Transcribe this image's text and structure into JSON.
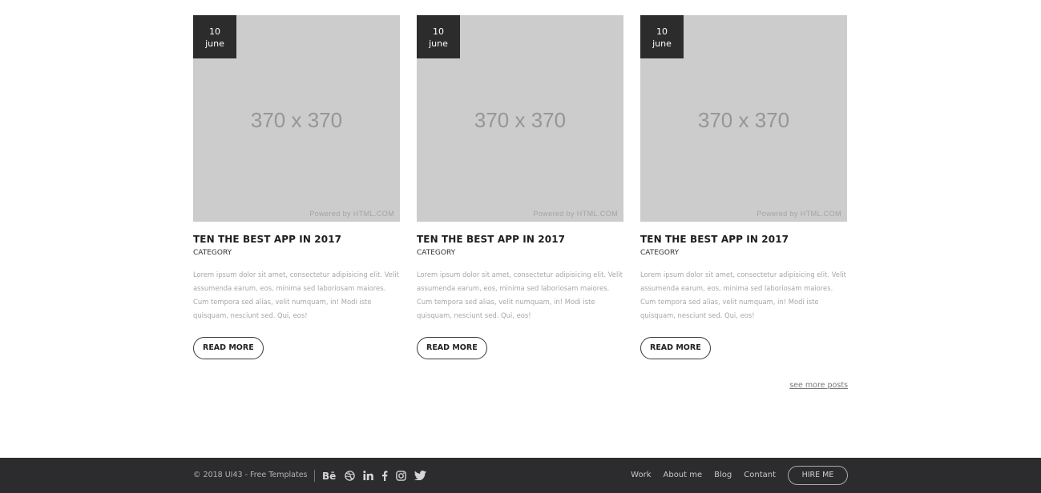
{
  "posts": [
    {
      "date_day": "10",
      "date_month": "june",
      "image_size_label": "370 x 370",
      "image_credit": "Powered by HTML.COM",
      "title": "TEN THE BEST APP IN 2017",
      "category": "CATEGORY",
      "excerpt": "Lorem ipsum dolor sit amet, consectetur adipisicing elit. Velit assumenda earum, eos, minima sed laboriosam maiores. Cum tempora sed alias, velit numquam, in! Modi iste quisquam, nesciunt sed. Qui, eos!",
      "button_label": "READ MORE"
    },
    {
      "date_day": "10",
      "date_month": "june",
      "image_size_label": "370 x 370",
      "image_credit": "Powered by HTML.COM",
      "title": "TEN THE BEST APP IN 2017",
      "category": "CATEGORY",
      "excerpt": "Lorem ipsum dolor sit amet, consectetur adipisicing elit. Velit assumenda earum, eos, minima sed laboriosam maiores. Cum tempora sed alias, velit numquam, in! Modi iste quisquam, nesciunt sed. Qui, eos!",
      "button_label": "READ MORE"
    },
    {
      "date_day": "10",
      "date_month": "june",
      "image_size_label": "370 x 370",
      "image_credit": "Powered by HTML.COM",
      "title": "TEN THE BEST APP IN 2017",
      "category": "CATEGORY",
      "excerpt": "Lorem ipsum dolor sit amet, consectetur adipisicing elit. Velit assumenda earum, eos, minima sed laboriosam maiores. Cum tempora sed alias, velit numquam, in! Modi iste quisquam, nesciunt sed. Qui, eos!",
      "button_label": "READ MORE"
    }
  ],
  "see_more_label": "see more posts",
  "footer": {
    "copyright": "© 2018 UI43 - Free Templates",
    "socials": [
      "behance-icon",
      "dribbble-icon",
      "linkedin-icon",
      "facebook-icon",
      "instagram-icon",
      "twitter-icon"
    ],
    "nav": [
      "Work",
      "About me",
      "Blog",
      "Contant"
    ],
    "hire_label": "HIRE ME"
  },
  "colors": {
    "footer_bg": "#2c2c2e",
    "date_badge_bg": "#2c2c2c",
    "placeholder_bg": "#cccccc",
    "text_dark": "#1e1e1e",
    "text_muted": "#a7a7a7"
  }
}
